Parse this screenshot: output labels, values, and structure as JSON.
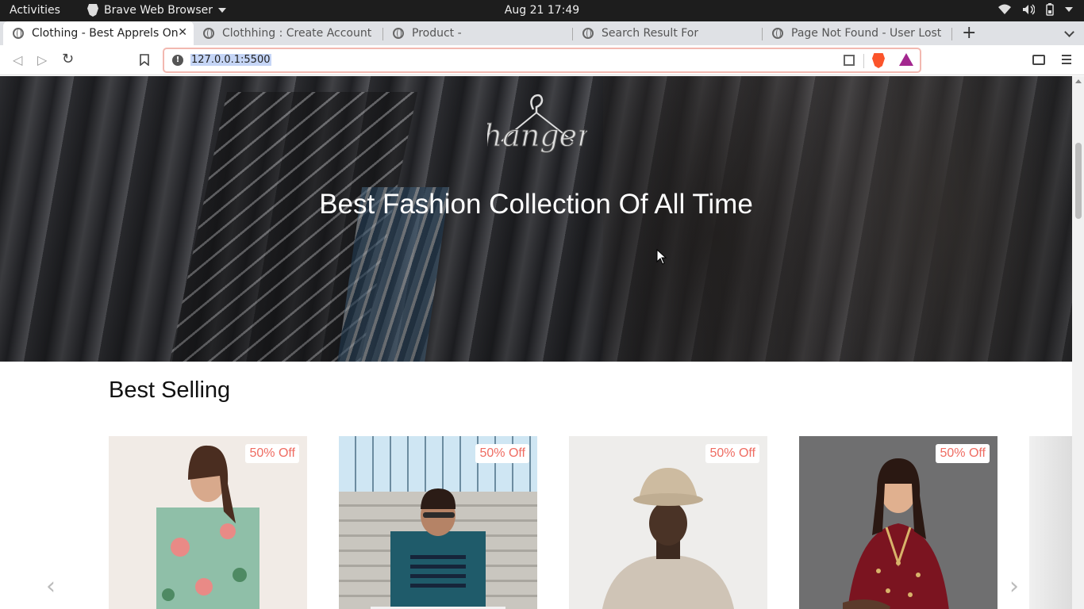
{
  "system": {
    "activities": "Activities",
    "app_name": "Brave Web Browser",
    "clock": "Aug 21  17:49"
  },
  "browser": {
    "tabs": [
      {
        "label": "Clothing - Best Apprels On",
        "active": true
      },
      {
        "label": "Clothhing : Create Account",
        "active": false
      },
      {
        "label": "Product -",
        "active": false
      },
      {
        "label": "Search Result For",
        "active": false
      },
      {
        "label": "Page Not Found - User Lost",
        "active": false
      }
    ],
    "url": "127.0.0.1:5500"
  },
  "hero": {
    "logo_text": "hanger",
    "title": "Best Fashion Collection Of All Time"
  },
  "best_selling": {
    "title": "Best Selling",
    "products": [
      {
        "badge": "50% Off",
        "icon": "woman-floral-dress"
      },
      {
        "badge": "50% Off",
        "icon": "man-striped-tshirt"
      },
      {
        "badge": "50% Off",
        "icon": "man-bucket-hat-sweatshirt"
      },
      {
        "badge": "50% Off",
        "icon": "woman-red-kurta"
      }
    ],
    "prev_icon": "chevron-left-icon",
    "next_icon": "chevron-right-icon"
  },
  "colors": {
    "badge_text": "#ef6c62",
    "url_focus_border": "#f2b8b0",
    "brave_orange": "#fb542b"
  }
}
